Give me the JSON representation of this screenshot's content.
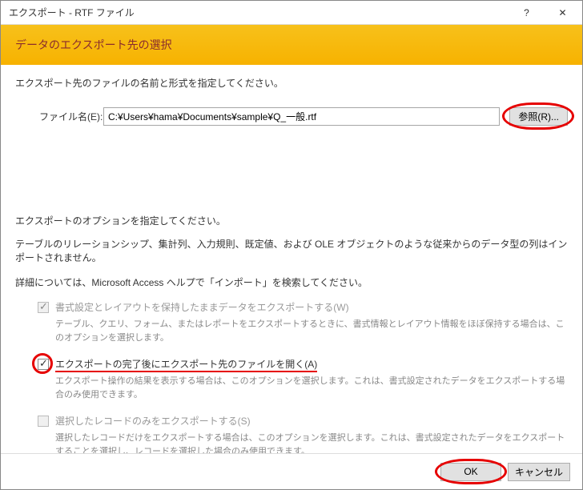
{
  "titlebar": {
    "title": "エクスポート - RTF ファイル",
    "help": "?",
    "close": "✕"
  },
  "header": {
    "title": "データのエクスポート先の選択"
  },
  "instructions": {
    "line1": "エクスポート先のファイルの名前と形式を指定してください。"
  },
  "file": {
    "label": "ファイル名(E):",
    "value": "C:¥Users¥hama¥Documents¥sample¥Q_一般.rtf",
    "browse": "参照(R)..."
  },
  "section2": {
    "instr": "エクスポートのオプションを指定してください。",
    "note1": "テーブルのリレーションシップ、集計列、入力規則、既定値、および OLE オブジェクトのような従来からのデータ型の列はインポートされません。",
    "note2": "詳細については、Microsoft Access ヘルプで「インポート」を検索してください。"
  },
  "options": {
    "opt1": {
      "label": "書式設定とレイアウトを保持したままデータをエクスポートする(W)",
      "desc": "テーブル、クエリ、フォーム、またはレポートをエクスポートするときに、書式情報とレイアウト情報をほぼ保持する場合は、このオプションを選択します。",
      "checked": true,
      "disabled": true
    },
    "opt2": {
      "label": "エクスポートの完了後にエクスポート先のファイルを開く(A)",
      "desc": "エクスポート操作の結果を表示する場合は、このオプションを選択します。これは、書式設定されたデータをエクスポートする場合のみ使用できます。",
      "checked": true,
      "disabled": false
    },
    "opt3": {
      "label": "選択したレコードのみをエクスポートする(S)",
      "desc": "選択したレコードだけをエクスポートする場合は、このオプションを選択します。これは、書式設定されたデータをエクスポートすることを選択し、レコードを選択した場合のみ使用できます。",
      "checked": false,
      "disabled": true
    }
  },
  "footer": {
    "ok": "OK",
    "cancel": "キャンセル"
  }
}
